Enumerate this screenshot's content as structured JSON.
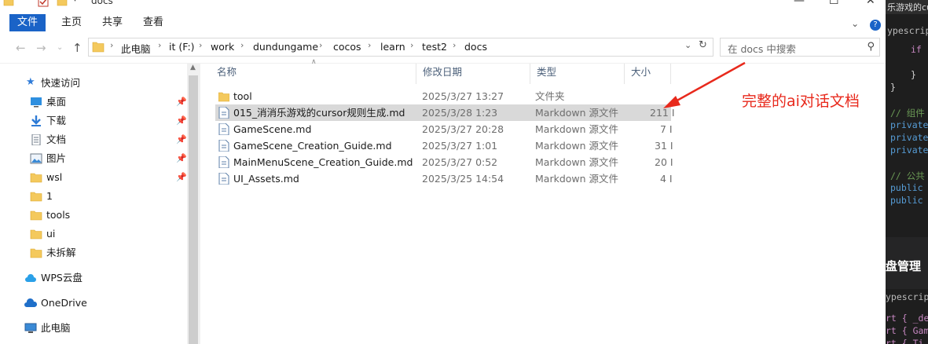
{
  "window": {
    "title": "docs",
    "controls": {
      "minimize": "—",
      "maximize": "☐",
      "close": "✕"
    }
  },
  "ribbon": {
    "tabs": [
      "文件",
      "主页",
      "共享",
      "查看"
    ],
    "expand_icon": "chevron-down-icon",
    "help_icon": "help-icon"
  },
  "address": {
    "path": [
      "此电脑",
      "it (F:)",
      "work",
      "dundungame",
      "cocos",
      "learn",
      "test2",
      "docs"
    ],
    "search_placeholder": "在 docs 中搜索"
  },
  "nav": {
    "quick_access": "快速访问",
    "items": [
      {
        "label": "桌面",
        "icon": "desktop-icon",
        "pinned": true
      },
      {
        "label": "下载",
        "icon": "download-icon",
        "pinned": true
      },
      {
        "label": "文档",
        "icon": "document-icon",
        "pinned": true
      },
      {
        "label": "图片",
        "icon": "pictures-icon",
        "pinned": true
      },
      {
        "label": "wsl",
        "icon": "folder-icon",
        "pinned": true
      },
      {
        "label": "1",
        "icon": "folder-icon",
        "pinned": false
      },
      {
        "label": "tools",
        "icon": "folder-icon",
        "pinned": false
      },
      {
        "label": "ui",
        "icon": "folder-icon",
        "pinned": false
      },
      {
        "label": "未拆解",
        "icon": "folder-icon",
        "pinned": false
      }
    ],
    "wps": "WPS云盘",
    "onedrive": "OneDrive",
    "thispc": "此电脑"
  },
  "columns": {
    "name": "名称",
    "date": "修改日期",
    "type": "类型",
    "size": "大小"
  },
  "files": [
    {
      "name": "tool",
      "date": "2025/3/27 13:27",
      "type": "文件夹",
      "size": "",
      "kind": "folder"
    },
    {
      "name": "015_消消乐游戏的cursor规则生成.md",
      "date": "2025/3/28 1:23",
      "type": "Markdown 源文件",
      "size": "211 I",
      "kind": "md"
    },
    {
      "name": "GameScene.md",
      "date": "2025/3/27 20:28",
      "type": "Markdown 源文件",
      "size": "7 I",
      "kind": "md"
    },
    {
      "name": "GameScene_Creation_Guide.md",
      "date": "2025/3/27 1:01",
      "type": "Markdown 源文件",
      "size": "31 I",
      "kind": "md"
    },
    {
      "name": "MainMenuScene_Creation_Guide.md",
      "date": "2025/3/27 0:52",
      "type": "Markdown 源文件",
      "size": "20 I",
      "kind": "md"
    },
    {
      "name": "UI_Assets.md",
      "date": "2025/3/25 14:54",
      "type": "Markdown 源文件",
      "size": "4 I",
      "kind": "md"
    }
  ],
  "annotation": "完整的ai对话文档",
  "annotation_color": "#e8291c",
  "accent_color": "#1a63c7",
  "editor": {
    "title": "乐游戏的cu",
    "lines": [
      "ypescript",
      "if (",
      "}",
      "}",
      "// 组件",
      "private",
      "private",
      "private",
      "// 公共",
      "public",
      "public"
    ],
    "heading": "盘管理",
    "lines2": [
      "ypescript",
      "rt { _de",
      "rt { Gam",
      "rt { Ti"
    ]
  }
}
